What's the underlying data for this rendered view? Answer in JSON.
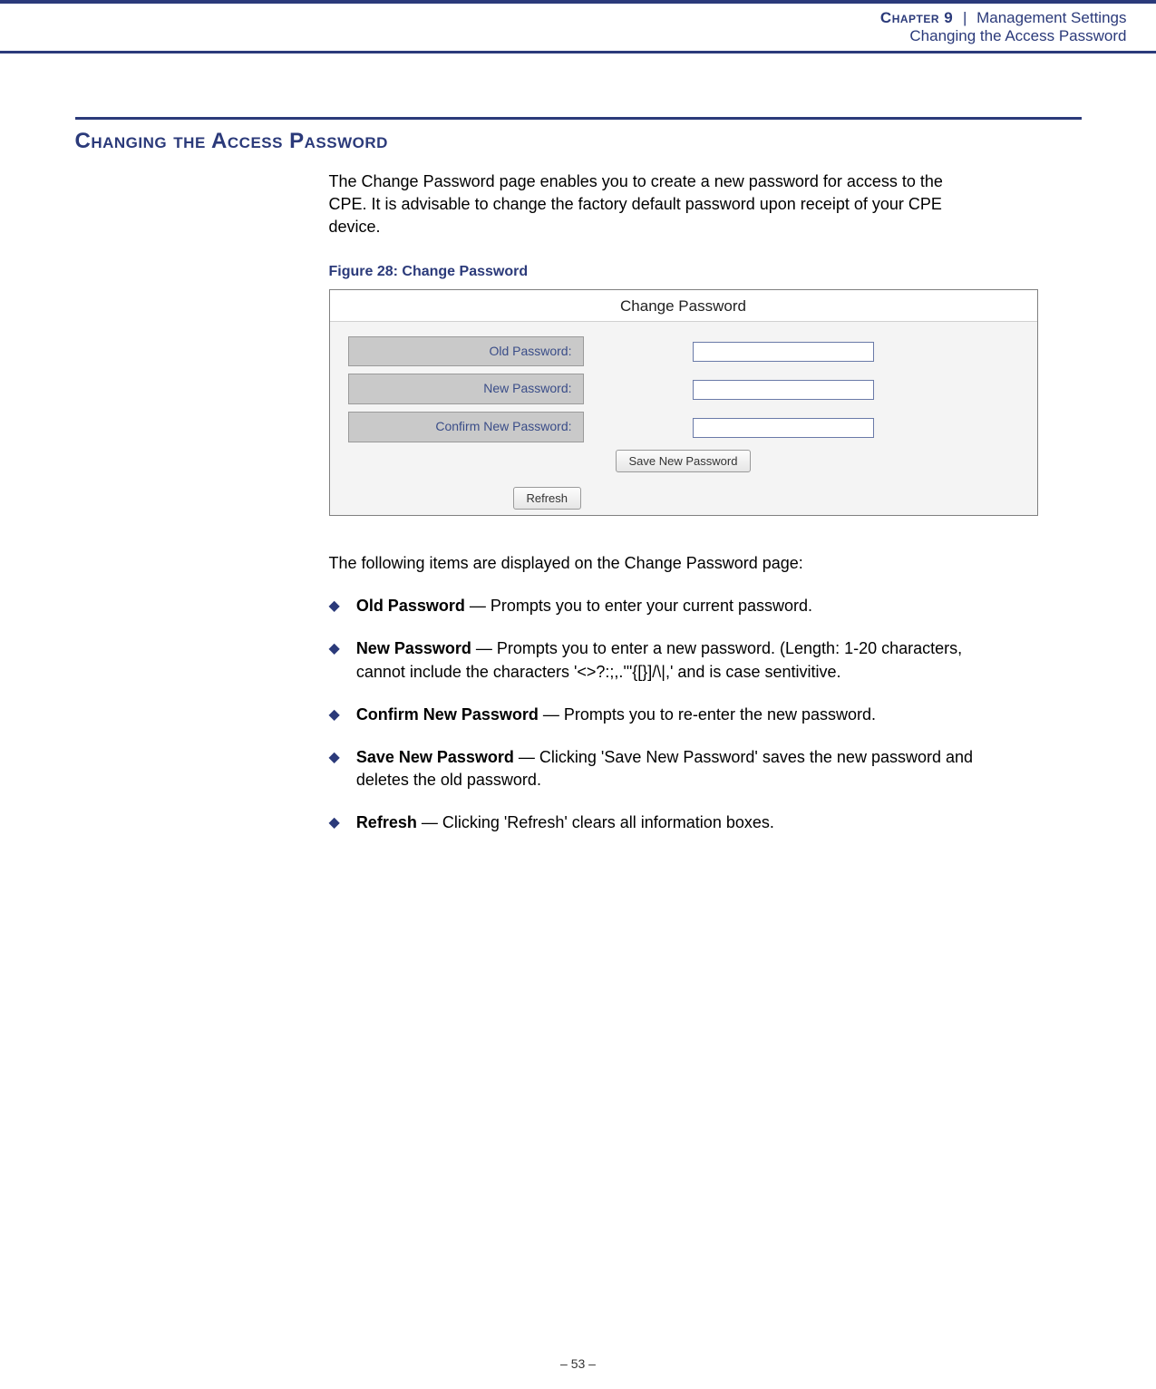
{
  "header": {
    "chapter_label": "Chapter 9",
    "chapter_title": "Management Settings",
    "sub_line": "Changing the Access Password"
  },
  "section": {
    "heading": "Changing the Access Password",
    "intro": "The Change Password page enables you to create a new password for access to the CPE. It is advisable to change the factory default password upon receipt of your CPE device."
  },
  "figure": {
    "caption": "Figure 28:  Change Password",
    "title": "Change Password",
    "rows": [
      {
        "label": "Old Password:",
        "value": ""
      },
      {
        "label": "New Password:",
        "value": ""
      },
      {
        "label": "Confirm New Password:",
        "value": ""
      }
    ],
    "save_btn": "Save New Password",
    "refresh_btn": "Refresh"
  },
  "list_intro": "The following items are displayed on the Change Password page:",
  "items": [
    {
      "term": "Old Password",
      "desc": " — Prompts you to enter your current password."
    },
    {
      "term": "New Password",
      "desc": " — Prompts you to enter a new password. (Length: 1-20 characters, cannot include the characters '<>?:;,.'\"{[}]/\\|,' and is case sentivitive."
    },
    {
      "term": "Confirm New Password",
      "desc": " — Prompts you to re-enter the new password."
    },
    {
      "term": "Save New Password",
      "desc": " — Clicking 'Save New Password' saves the new password and deletes the old password."
    },
    {
      "term": "Refresh",
      "desc": " — Clicking 'Refresh' clears all information boxes."
    }
  ],
  "footer": {
    "page": "–  53  –"
  }
}
